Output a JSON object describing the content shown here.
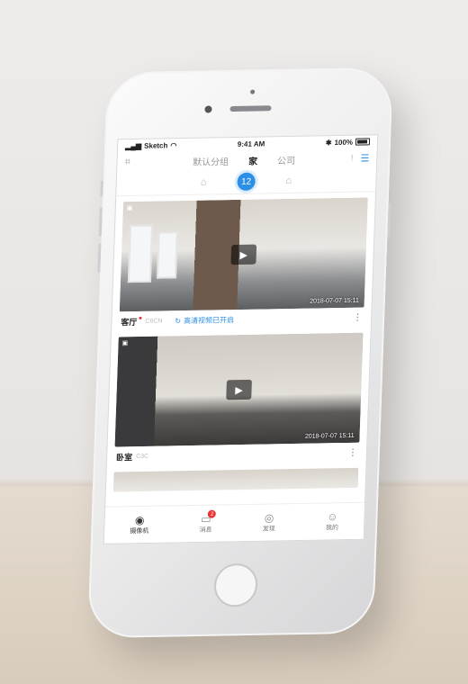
{
  "status_bar": {
    "carrier": "Sketch",
    "time": "9:41 AM",
    "battery": "100%"
  },
  "top_nav": {
    "scan_icon": "scan-icon",
    "tabs": [
      {
        "label": "默认分组",
        "active": false
      },
      {
        "label": "家",
        "active": true
      },
      {
        "label": "公司",
        "active": false
      }
    ],
    "more_label": "!",
    "list_icon": "list-icon"
  },
  "rooms": {
    "left_icon": "room-icon",
    "active_label": "12",
    "right_icon": "room-icon-2"
  },
  "cameras": [
    {
      "name": "客厅",
      "sub": "C6CN",
      "status": "高清视频已开启",
      "timestamp": "2018-07-07 15:11",
      "has_alert_dot": true
    },
    {
      "name": "卧室",
      "sub": "C3C",
      "status": "",
      "timestamp": "2018-07-07 15:11",
      "has_alert_dot": false
    }
  ],
  "tabbar": {
    "items": [
      {
        "label": "摄像机",
        "icon": "camera-icon",
        "active": true
      },
      {
        "label": "消息",
        "icon": "message-icon",
        "active": false,
        "badge": "2"
      },
      {
        "label": "发现",
        "icon": "discover-icon",
        "active": false
      },
      {
        "label": "我的",
        "icon": "profile-icon",
        "active": false
      }
    ]
  }
}
